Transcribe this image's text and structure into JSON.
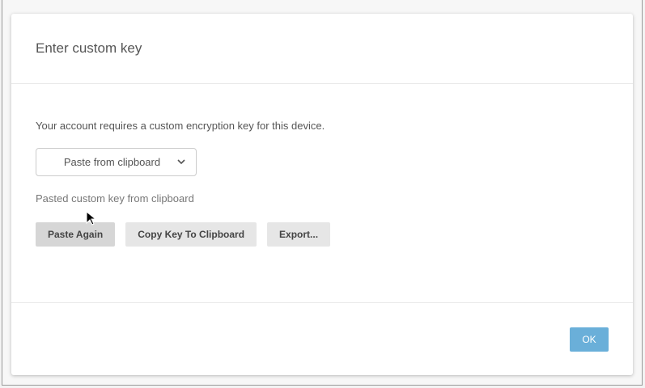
{
  "dialog": {
    "title": "Enter custom key",
    "description": "Your account requires a custom encryption key for this device.",
    "source_select": {
      "value": "Paste from clipboard"
    },
    "status": "Pasted custom key from clipboard",
    "buttons": {
      "paste_again": "Paste Again",
      "copy_key": "Copy Key To Clipboard",
      "export": "Export..."
    },
    "ok_label": "OK"
  },
  "colors": {
    "ok_button": "#6aafd9"
  }
}
